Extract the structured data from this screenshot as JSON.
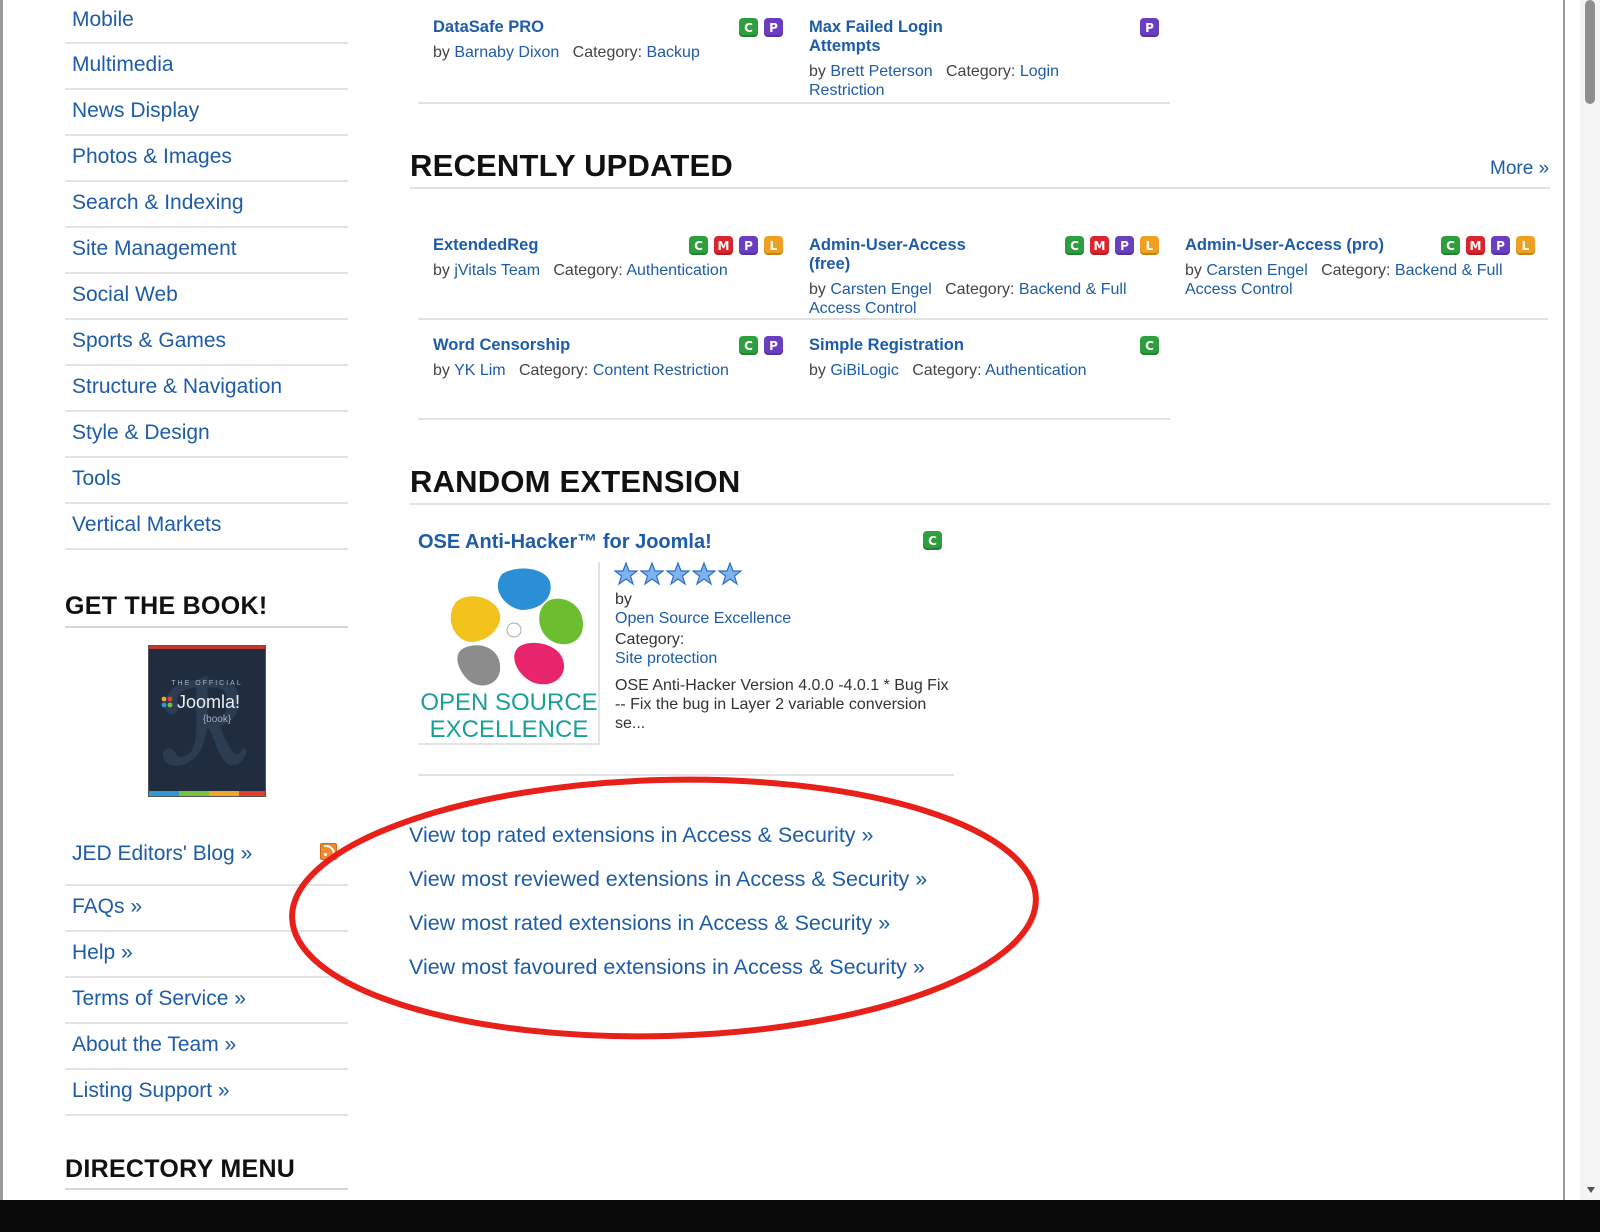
{
  "sidebar": {
    "categories": [
      "Mobile",
      "Multimedia",
      "News Display",
      "Photos & Images",
      "Search & Indexing",
      "Site Management",
      "Social Web",
      "Sports & Games",
      "Structure & Navigation",
      "Style & Design",
      "Tools",
      "Vertical Markets"
    ],
    "book_heading": "GET THE BOOK!",
    "book": {
      "small": "THE OFFICIAL",
      "title": "Joomla!",
      "subtitle": "{book}"
    },
    "links": [
      "JED Editors' Blog »",
      "FAQs »",
      "Help »",
      "Terms of Service »",
      "About the Team »",
      "Listing Support »"
    ],
    "directory_heading": "DIRECTORY MENU"
  },
  "top_extensions": [
    {
      "title": "DataSafe PRO",
      "by_label": "by",
      "author": "Barnaby Dixon",
      "category_label": "Category:",
      "category": "Backup",
      "badges": [
        "C",
        "P"
      ]
    },
    {
      "title": "Max Failed Login Attempts",
      "by_label": "by",
      "author": "Brett Peterson",
      "category_label": "Category:",
      "category": "Login Restriction",
      "badges": [
        "P"
      ]
    }
  ],
  "recently_updated": {
    "title": "RECENTLY UPDATED",
    "more": "More »",
    "items": [
      {
        "title": "ExtendedReg",
        "by_label": "by",
        "author": "jVitals Team",
        "category_label": "Category:",
        "category": "Authentication",
        "badges": [
          "C",
          "M",
          "P",
          "L"
        ]
      },
      {
        "title": "Admin-User-Access (free)",
        "by_label": "by",
        "author": "Carsten Engel",
        "category_label": "Category:",
        "category": "Backend & Full Access Control",
        "badges": [
          "C",
          "M",
          "P",
          "L"
        ]
      },
      {
        "title": "Admin-User-Access (pro)",
        "by_label": "by",
        "author": "Carsten Engel",
        "category_label": "Category:",
        "category": "Backend & Full Access Control",
        "badges": [
          "C",
          "M",
          "P",
          "L"
        ]
      },
      {
        "title": "Word Censorship",
        "by_label": "by",
        "author": "YK Lim",
        "category_label": "Category:",
        "category": "Content Restriction",
        "badges": [
          "C",
          "P"
        ]
      },
      {
        "title": "Simple Registration",
        "by_label": "by",
        "author": "GiBiLogic",
        "category_label": "Category:",
        "category": "Authentication",
        "badges": [
          "C"
        ]
      }
    ]
  },
  "random_extension": {
    "title": "RANDOM EXTENSION",
    "name": "OSE Anti-Hacker™ for Joomla!",
    "badges": [
      "C"
    ],
    "rating": 5,
    "by_label": "by",
    "author": "Open Source Excellence",
    "category_label": "Category:",
    "category": "Site protection",
    "description": "OSE Anti-Hacker Version 4.0.0 -4.0.1 * Bug Fix -- Fix the bug in Layer 2 variable conversion se...",
    "logo_text_line1": "OPEN SOURCE",
    "logo_text_line2": "EXCELLENCE"
  },
  "view_links": [
    "View top rated extensions in Access & Security »",
    "View most reviewed extensions in Access & Security »",
    "View most rated extensions in Access & Security »",
    "View most favoured extensions in Access & Security »"
  ],
  "colors": {
    "link": "#1e5ca8",
    "annotation": "#e8201a",
    "badge_c": "#2e9e3e",
    "badge_m": "#d9252e",
    "badge_p": "#6a3ec0",
    "badge_l": "#f0a020"
  }
}
